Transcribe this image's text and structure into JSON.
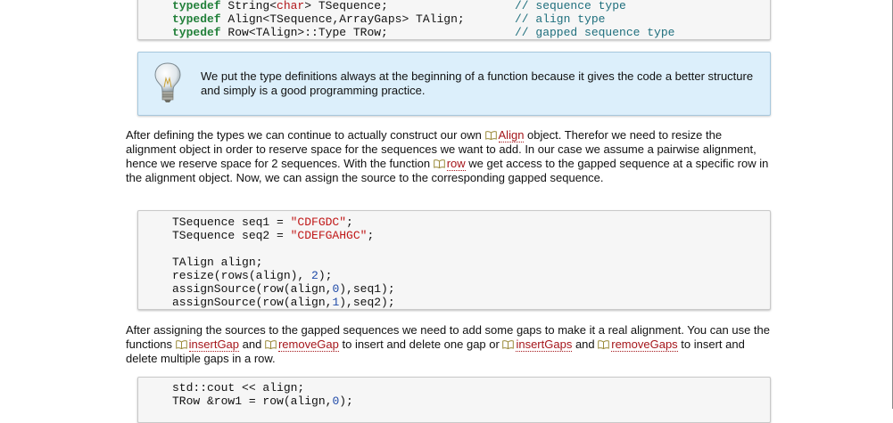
{
  "code_top": {
    "lines": [
      {
        "kw": "typedef",
        "type_pre": "String<",
        "type_hl": "char",
        "type_post": "> TSequence;",
        "comment": "// sequence type"
      },
      {
        "kw": "typedef",
        "type_pre": "Align<TSequence,ArrayGaps> TAlign;",
        "type_hl": "",
        "type_post": "",
        "comment": "// align type"
      },
      {
        "kw": "typedef",
        "type_pre": "Row<TAlign>::Type TRow;",
        "type_hl": "",
        "type_post": "",
        "comment": "// gapped sequence type"
      }
    ]
  },
  "note": {
    "icon": "lightbulb-icon",
    "text": "We put the type definitions always at the beginning of a function because it gives the code a better structure and simply is a good programming practice."
  },
  "para1": {
    "t1": "After defining the types we can continue to actually construct our own ",
    "link1": "Align",
    "t2": " object. Therefor we need to resize the alignment object in order to reserve space for the sequences we want to add. In our case we assume a pairwise alignment, hence we reserve space for 2 sequences. With the function ",
    "link2": "row",
    "t3": " we get access to the gapped sequence at a specific row in the alignment object. Now, we can assign the source to the corresponding gapped sequence."
  },
  "code_mid": {
    "l1a": "TSequence seq1 = ",
    "l1s": "\"CDFGDC\"",
    "l1b": ";",
    "l2a": "TSequence seq2 = ",
    "l2s": "\"CDEFGAHGC\"",
    "l2b": ";",
    "l3": "TAlign align;",
    "l4a": "resize(rows(align), ",
    "l4n": "2",
    "l4b": ");",
    "l5a": "assignSource(row(align,",
    "l5n": "0",
    "l5b": "),seq1);",
    "l6a": "assignSource(row(align,",
    "l6n": "1",
    "l6b": "),seq2);"
  },
  "para2": {
    "t1": "After assigning the sources to the gapped sequences we need to add some gaps to make it a real alignment. You can use the functions ",
    "link1": "insertGap",
    "t2": " and ",
    "link2": "removeGap",
    "t3": " to insert and delete one gap or ",
    "link3": "insertGaps",
    "t4": " and ",
    "link4": "removeGaps",
    "t5": " to insert and delete multiple gaps in a row."
  },
  "code_bottom": {
    "l1": "std::cout << align;",
    "l2a": "TRow &row1 = row(align,",
    "l2n": "0",
    "l2b": ");"
  },
  "colors": {
    "keyword": "#22803a",
    "type_highlight": "#b3191d",
    "comment": "#1f6f7d",
    "string": "#c01818",
    "number": "#1f4aa8",
    "link": "#a5161b",
    "note_bg": "#dceffb"
  },
  "link_icon": "book-icon"
}
